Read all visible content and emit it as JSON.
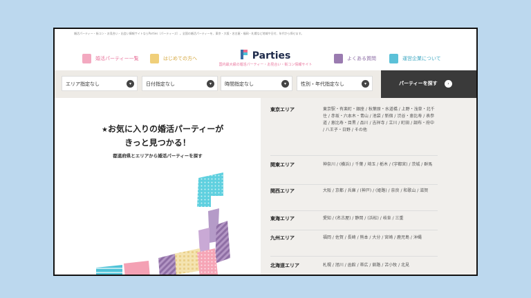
{
  "notice": "婚活パーティー・街コン・お見合い・出会い情報サイトならParties（パーティーズ）。全国の婚活パーティーを、東京・大阪・名古屋・福岡・札幌など地域や日付、年代から探せます。",
  "header": {
    "nav_left": [
      {
        "label": "婚活パーティー一覧",
        "icon": "list-icon"
      },
      {
        "label": "はじめての方へ",
        "icon": "book-icon"
      }
    ],
    "nav_right": [
      {
        "label": "よくある質問",
        "icon": "question-icon"
      },
      {
        "label": "運営企業について",
        "icon": "building-icon"
      }
    ],
    "logo": {
      "name": "Parties",
      "tagline": "国内最大級の婚活パーティー・お見合い・街コン情報サイト"
    }
  },
  "search": {
    "selects": [
      "エリア指定なし",
      "日付指定なし",
      "時間指定なし",
      "性別・年代指定なし"
    ],
    "button": "パーティーを探す"
  },
  "hero": {
    "line1": "お気に入りの婚活パーティーが",
    "line2": "きっと見つかる！",
    "sub": "都道府県とエリアから婚活パーティーを探す"
  },
  "regions": [
    {
      "name": "東京エリア",
      "cities": "東京駅・有楽町・銀座 / 秋葉原・水道橋 / 上野・浅草・北千住 / 赤坂・六本木・青山 / 池袋 / 新宿 / 渋谷・恵比寿 / 表参道 / 恵比寿・目黒 / 品川 / 吉祥寺 / 立川 / 町田 / 調布・府中 / 八王子・日野 / その他"
    },
    {
      "name": "関東エリア",
      "cities": "神奈川 / (横浜) / 千葉 / 埼玉 / 栃木 / (宇都宮) / 茨城 / 群馬"
    },
    {
      "name": "関西エリア",
      "cities": "大阪 / 京都 / 兵庫 / (神戸) / (姫路) / 奈良 / 和歌山 / 滋賀"
    },
    {
      "name": "東海エリア",
      "cities": "愛知 / (名古屋) / 静岡 / (浜松) / 岐阜 / 三重"
    },
    {
      "name": "九州エリア",
      "cities": "福岡 / 佐賀 / 長崎 / 熊本 / 大分 / 宮崎 / 鹿児島 / 沖縄"
    },
    {
      "name": "北海道エリア",
      "cities": "札幌 / 旭川 / 函館 / 帯広 / 釧路 / 苫小牧 / 北見"
    }
  ],
  "colors": {
    "accent_pink": "#e8739b",
    "dark": "#3a3a3a",
    "logo_navy": "#1e2a4a"
  }
}
